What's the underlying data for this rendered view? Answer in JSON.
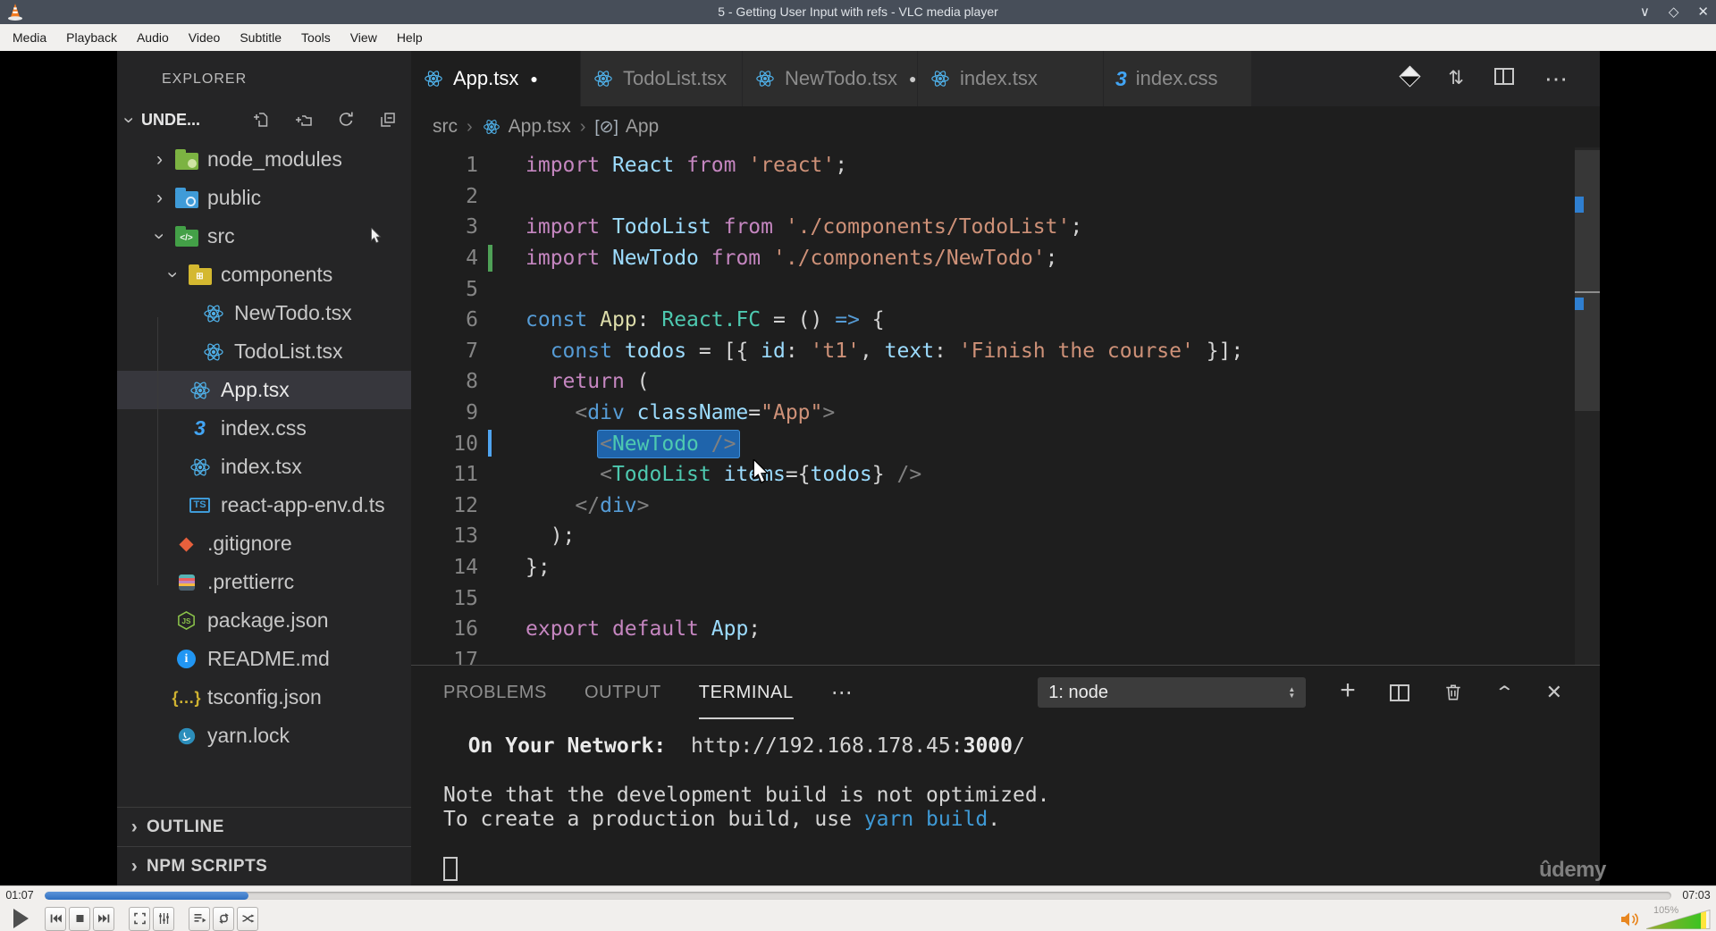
{
  "window": {
    "title": "5 - Getting User Input with refs - VLC media player",
    "controls": [
      "minimize",
      "maximize",
      "close"
    ]
  },
  "menu": {
    "items": [
      "Media",
      "Playback",
      "Audio",
      "Video",
      "Subtitle",
      "Tools",
      "View",
      "Help"
    ]
  },
  "explorer": {
    "title": "EXPLORER",
    "section_label": "UNDE...",
    "toolbar": [
      "new-file",
      "new-folder",
      "refresh",
      "collapse-all"
    ],
    "tree": [
      {
        "label": "node_modules",
        "icon": "folder-node",
        "indent": 0,
        "expanded": false
      },
      {
        "label": "public",
        "icon": "folder-public",
        "indent": 0,
        "expanded": false
      },
      {
        "label": "src",
        "icon": "folder-src",
        "indent": 0,
        "expanded": true,
        "cursor": true
      },
      {
        "label": "components",
        "icon": "folder-components",
        "indent": 1,
        "expanded": true
      },
      {
        "label": "NewTodo.tsx",
        "icon": "react",
        "indent": 2
      },
      {
        "label": "TodoList.tsx",
        "icon": "react",
        "indent": 2
      },
      {
        "label": "App.tsx",
        "icon": "react",
        "indent": 1,
        "selected": true
      },
      {
        "label": "index.css",
        "icon": "css",
        "indent": 1
      },
      {
        "label": "index.tsx",
        "icon": "react",
        "indent": 1
      },
      {
        "label": "react-app-env.d.ts",
        "icon": "ts",
        "indent": 1
      },
      {
        "label": ".gitignore",
        "icon": "git",
        "indent": 0
      },
      {
        "label": ".prettierrc",
        "icon": "prettier",
        "indent": 0
      },
      {
        "label": "package.json",
        "icon": "node",
        "indent": 0
      },
      {
        "label": "README.md",
        "icon": "info",
        "indent": 0
      },
      {
        "label": "tsconfig.json",
        "icon": "braces",
        "indent": 0
      },
      {
        "label": "yarn.lock",
        "icon": "yarn",
        "indent": 0
      }
    ],
    "bottom_sections": [
      "OUTLINE",
      "NPM SCRIPTS"
    ]
  },
  "editor": {
    "tabs": [
      {
        "label": "App.tsx",
        "icon": "react",
        "dirty": true,
        "active": true
      },
      {
        "label": "TodoList.tsx",
        "icon": "react",
        "dirty": false,
        "active": false
      },
      {
        "label": "NewTodo.tsx",
        "icon": "react",
        "dirty": true,
        "active": false
      },
      {
        "label": "index.tsx",
        "icon": "react",
        "dirty": false,
        "active": false
      },
      {
        "label": "index.css",
        "icon": "css",
        "dirty": false,
        "active": false
      }
    ],
    "actions": [
      "prettier",
      "compare-changes",
      "split-editor",
      "more-actions"
    ],
    "breadcrumb": [
      {
        "label": "src"
      },
      {
        "label": "App.tsx",
        "icon": "react"
      },
      {
        "label": "App",
        "icon": "symbol-module"
      }
    ],
    "code_lines": [
      {
        "n": "1",
        "tokens": [
          [
            "k",
            "import"
          ],
          [
            "pl",
            " "
          ],
          [
            "id",
            "React"
          ],
          [
            "pl",
            " "
          ],
          [
            "k",
            "from"
          ],
          [
            "pl",
            " "
          ],
          [
            "str",
            "'react'"
          ],
          [
            "pl",
            ";"
          ]
        ]
      },
      {
        "n": "2",
        "tokens": []
      },
      {
        "n": "3",
        "tokens": [
          [
            "k",
            "import"
          ],
          [
            "pl",
            " "
          ],
          [
            "id",
            "TodoList"
          ],
          [
            "pl",
            " "
          ],
          [
            "k",
            "from"
          ],
          [
            "pl",
            " "
          ],
          [
            "str",
            "'./components/TodoList'"
          ],
          [
            "pl",
            ";"
          ]
        ]
      },
      {
        "n": "4",
        "marker": "modified",
        "tokens": [
          [
            "k",
            "import"
          ],
          [
            "pl",
            " "
          ],
          [
            "id",
            "NewTodo"
          ],
          [
            "pl",
            " "
          ],
          [
            "k",
            "from"
          ],
          [
            "pl",
            " "
          ],
          [
            "str",
            "'./components/NewTodo'"
          ],
          [
            "pl",
            ";"
          ]
        ]
      },
      {
        "n": "5",
        "tokens": []
      },
      {
        "n": "6",
        "tokens": [
          [
            "kb",
            "const"
          ],
          [
            "pl",
            " "
          ],
          [
            "fn",
            "App"
          ],
          [
            "pl",
            ": "
          ],
          [
            "ty",
            "React.FC"
          ],
          [
            "pl",
            " = () "
          ],
          [
            "kb",
            "=>"
          ],
          [
            "pl",
            " {"
          ]
        ]
      },
      {
        "n": "7",
        "tokens": [
          [
            "pl",
            "  "
          ],
          [
            "kb",
            "const"
          ],
          [
            "pl",
            " "
          ],
          [
            "id",
            "todos"
          ],
          [
            "pl",
            " = [{ "
          ],
          [
            "id",
            "id"
          ],
          [
            "pl",
            ": "
          ],
          [
            "str",
            "'t1'"
          ],
          [
            "pl",
            ", "
          ],
          [
            "id",
            "text"
          ],
          [
            "pl",
            ": "
          ],
          [
            "str",
            "'Finish the course'"
          ],
          [
            "pl",
            " }];"
          ]
        ]
      },
      {
        "n": "8",
        "tokens": [
          [
            "pl",
            "  "
          ],
          [
            "k",
            "return"
          ],
          [
            "pl",
            " ("
          ]
        ]
      },
      {
        "n": "9",
        "tokens": [
          [
            "pl",
            "    "
          ],
          [
            "br",
            "<"
          ],
          [
            "tag",
            "div"
          ],
          [
            "pl",
            " "
          ],
          [
            "id",
            "className"
          ],
          [
            "pl",
            "="
          ],
          [
            "str",
            "\"App\""
          ],
          [
            "br",
            ">"
          ]
        ]
      },
      {
        "n": "10",
        "marker": "cursor",
        "tokens": [
          [
            "pl",
            "      "
          ],
          [
            "selbox",
            [
              [
                "br",
                "<"
              ],
              [
                "ty",
                "NewTodo"
              ],
              [
                "br",
                " />"
              ]
            ]
          ]
        ]
      },
      {
        "n": "11",
        "tokens": [
          [
            "pl",
            "      "
          ],
          [
            "br",
            "<"
          ],
          [
            "ty",
            "TodoList"
          ],
          [
            "pl",
            " "
          ],
          [
            "id",
            "items"
          ],
          [
            "pl",
            "={"
          ],
          [
            "id",
            "todos"
          ],
          [
            "pl",
            "} "
          ],
          [
            "br",
            "/>"
          ]
        ]
      },
      {
        "n": "12",
        "tokens": [
          [
            "pl",
            "    "
          ],
          [
            "br",
            "</"
          ],
          [
            "tag",
            "div"
          ],
          [
            "br",
            ">"
          ]
        ]
      },
      {
        "n": "13",
        "tokens": [
          [
            "pl",
            "  );"
          ]
        ]
      },
      {
        "n": "14",
        "tokens": [
          [
            "pl",
            "};"
          ]
        ]
      },
      {
        "n": "15",
        "tokens": []
      },
      {
        "n": "16",
        "tokens": [
          [
            "k",
            "export"
          ],
          [
            "pl",
            " "
          ],
          [
            "k",
            "default"
          ],
          [
            "pl",
            " "
          ],
          [
            "id",
            "App"
          ],
          [
            "pl",
            ";"
          ]
        ]
      },
      {
        "n": "17",
        "tokens": []
      }
    ]
  },
  "panel": {
    "tabs": [
      {
        "label": "PROBLEMS",
        "active": false
      },
      {
        "label": "OUTPUT",
        "active": false
      },
      {
        "label": "TERMINAL",
        "active": true
      }
    ],
    "dropdown_value": "1: node",
    "actions": [
      "new-terminal",
      "split-terminal",
      "kill-terminal",
      "maximize-panel",
      "close-panel"
    ],
    "terminal_lines": [
      {
        "tokens": [
          [
            "b",
            "  On Your Network:"
          ],
          [
            "pl",
            "  http://192.168.178.45:"
          ],
          [
            "b",
            "3000"
          ],
          [
            "pl",
            "/"
          ]
        ]
      },
      {
        "tokens": []
      },
      {
        "tokens": [
          [
            "pl",
            "Note that the development build is not optimized."
          ]
        ]
      },
      {
        "tokens": [
          [
            "pl",
            "To create a production build, use "
          ],
          [
            "cy",
            "yarn build"
          ],
          [
            "pl",
            "."
          ]
        ]
      },
      {
        "tokens": []
      },
      {
        "tokens": [
          [
            "tcursor",
            ""
          ]
        ]
      }
    ]
  },
  "watermark": "ûdemy",
  "vlc": {
    "current_time": "01:07",
    "total_time": "07:03",
    "seek_fraction": 0.125,
    "volume_label": "105%",
    "volume_fraction": 0.85,
    "transport_groups": [
      [
        "previous",
        "stop",
        "next"
      ],
      [
        "fullscreen",
        "extended-settings"
      ],
      [
        "playlist",
        "loop",
        "random"
      ]
    ]
  }
}
